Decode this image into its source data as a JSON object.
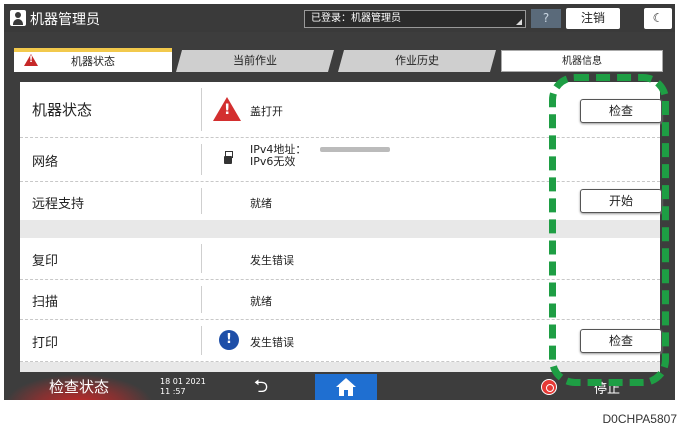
{
  "titlebar": {
    "app_title": "机器管理员",
    "login_status": "已登录：机器管理员",
    "help_label": "?",
    "logout_label": "注销",
    "moon_label": "☾"
  },
  "tabs": [
    {
      "label": "机器状态",
      "active": true,
      "warning": true
    },
    {
      "label": "当前作业"
    },
    {
      "label": "作业历史"
    },
    {
      "label": "机器信息"
    }
  ],
  "status_rows": [
    {
      "label": "机器状态",
      "value": "盖打开",
      "icon": "warning-icon",
      "button": "检查"
    },
    {
      "label": "网络",
      "value_line1": "IPv4地址：",
      "value_line2": "IPv6无效",
      "icon": "usb-icon"
    },
    {
      "label": "远程支持",
      "value": "就绪",
      "button": "开始"
    },
    {
      "label": "复印",
      "value": "发生错误"
    },
    {
      "label": "扫描",
      "value": "就绪"
    },
    {
      "label": "打印",
      "value": "发生错误",
      "icon": "info-icon",
      "button": "检查"
    }
  ],
  "bottombar": {
    "title": "检查状态",
    "date": "18 01 2021",
    "time": "11 :57",
    "stop_label": "停止"
  },
  "figure_code": "D0CHPA5807",
  "colors": {
    "accent_tab": "#f2c94c",
    "warning": "#d32f2f",
    "info": "#1e4fa8",
    "home": "#1f6fd1",
    "callout": "#1e9e44"
  }
}
